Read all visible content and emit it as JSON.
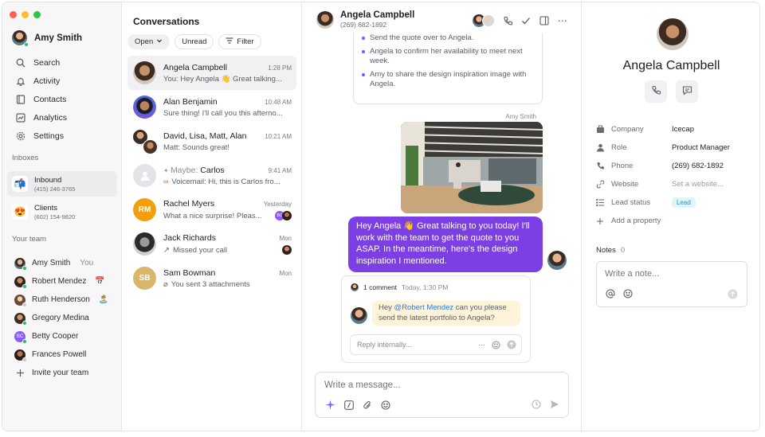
{
  "colors": {
    "accent": "#7b3fe4",
    "bubble_text": "#ffffff",
    "mention": "#2f7bd6",
    "online": "#2dbd60",
    "lead_badge_bg": "#e1f3fb",
    "lead_badge_text": "#2a8fbd",
    "comment_bg": "#fdf3d9",
    "traffic_red": "#ff5f57",
    "traffic_yellow": "#febc2e",
    "traffic_green": "#28c840"
  },
  "sidebar": {
    "user_name": "Amy Smith",
    "nav": [
      {
        "label": "Search",
        "icon": "search-icon"
      },
      {
        "label": "Activity",
        "icon": "bell-icon"
      },
      {
        "label": "Contacts",
        "icon": "contacts-book-icon"
      },
      {
        "label": "Analytics",
        "icon": "analytics-icon"
      },
      {
        "label": "Settings",
        "icon": "gear-icon"
      }
    ],
    "inboxes_label": "Inboxes",
    "inboxes": [
      {
        "name": "Inbound",
        "phone": "(415) 246-3765",
        "emoji": "📬"
      },
      {
        "name": "Clients",
        "phone": "(602) 154-9820",
        "emoji": "😍"
      }
    ],
    "team_label": "Your team",
    "team": [
      {
        "name": "Amy Smith",
        "suffix": "You",
        "emoji": ""
      },
      {
        "name": "Robert Mendez",
        "suffix": "",
        "emoji": "📅"
      },
      {
        "name": "Ruth Henderson",
        "suffix": "",
        "emoji": "🏝️"
      },
      {
        "name": "Gregory Medina",
        "suffix": "",
        "emoji": ""
      },
      {
        "name": "Betty Cooper",
        "suffix": "",
        "emoji": "",
        "initials": "BC"
      },
      {
        "name": "Frances Powell",
        "suffix": "",
        "emoji": ""
      }
    ],
    "invite_label": "Invite your team"
  },
  "conversations": {
    "title": "Conversations",
    "filters": {
      "open": "Open",
      "unread": "Unread",
      "filter": "Filter"
    },
    "items": [
      {
        "name": "Angela Campbell",
        "time": "1:28 PM",
        "preview": "You: Hey Angela 👋 Great talking..."
      },
      {
        "name": "Alan Benjamin",
        "time": "10:48 AM",
        "preview": "Sure thing! I'll call you this afterno..."
      },
      {
        "name": "David, Lisa, Matt, Alan",
        "time": "10:21 AM",
        "preview": "Matt: Sounds great!"
      },
      {
        "name_prefix": "Maybe:",
        "name": "Carlos",
        "time": "9:41 AM",
        "preview": "Voicemail: Hi, this is Carlos fro..."
      },
      {
        "name": "Rachel Myers",
        "initials": "RM",
        "time": "Yesterday",
        "preview": "What a nice surprise! Pleas...",
        "badge_initials": "BC"
      },
      {
        "name": "Jack Richards",
        "time": "Mon",
        "preview": "Missed your call"
      },
      {
        "name": "Sam Bowman",
        "initials": "SB",
        "time": "Mon",
        "preview": "You sent 3 attachments"
      }
    ]
  },
  "chat": {
    "contact_name": "Angela Campbell",
    "contact_phone": "(269) 682-1892",
    "summary_items": [
      "Send the quote over to Angela.",
      "Angela to confirm her availability to meet next week.",
      "Amy to share the design inspiration image with Angela."
    ],
    "sender": "Amy Smith",
    "message": "Hey Angela 👋 Great talking to you today! I'll work with the team to get the quote to you ASAP. In the meantime, here's the design inspiration I mentioned.",
    "comment": {
      "count_label": "1 comment",
      "time": "Today, 1:30 PM",
      "text_before": "Hey ",
      "mention": "@Robert Mendez",
      "text_after": " can you please send the latest portfolio to Angela?",
      "reply_placeholder": "Reply internally..."
    },
    "composer_placeholder": "Write a message..."
  },
  "details": {
    "name": "Angela Campbell",
    "properties": [
      {
        "label": "Company",
        "value": "Icecap",
        "icon": "building-icon"
      },
      {
        "label": "Role",
        "value": "Product Manager",
        "icon": "person-icon"
      },
      {
        "label": "Phone",
        "value": "(269) 682-1892",
        "icon": "phone-icon"
      },
      {
        "label": "Website",
        "value": "Set a website...",
        "icon": "link-icon"
      },
      {
        "label": "Lead status",
        "value": "Lead",
        "icon": "list-icon"
      }
    ],
    "add_property": "Add a property",
    "notes_label": "Notes",
    "notes_count": "0",
    "notes_placeholder": "Write a note..."
  }
}
